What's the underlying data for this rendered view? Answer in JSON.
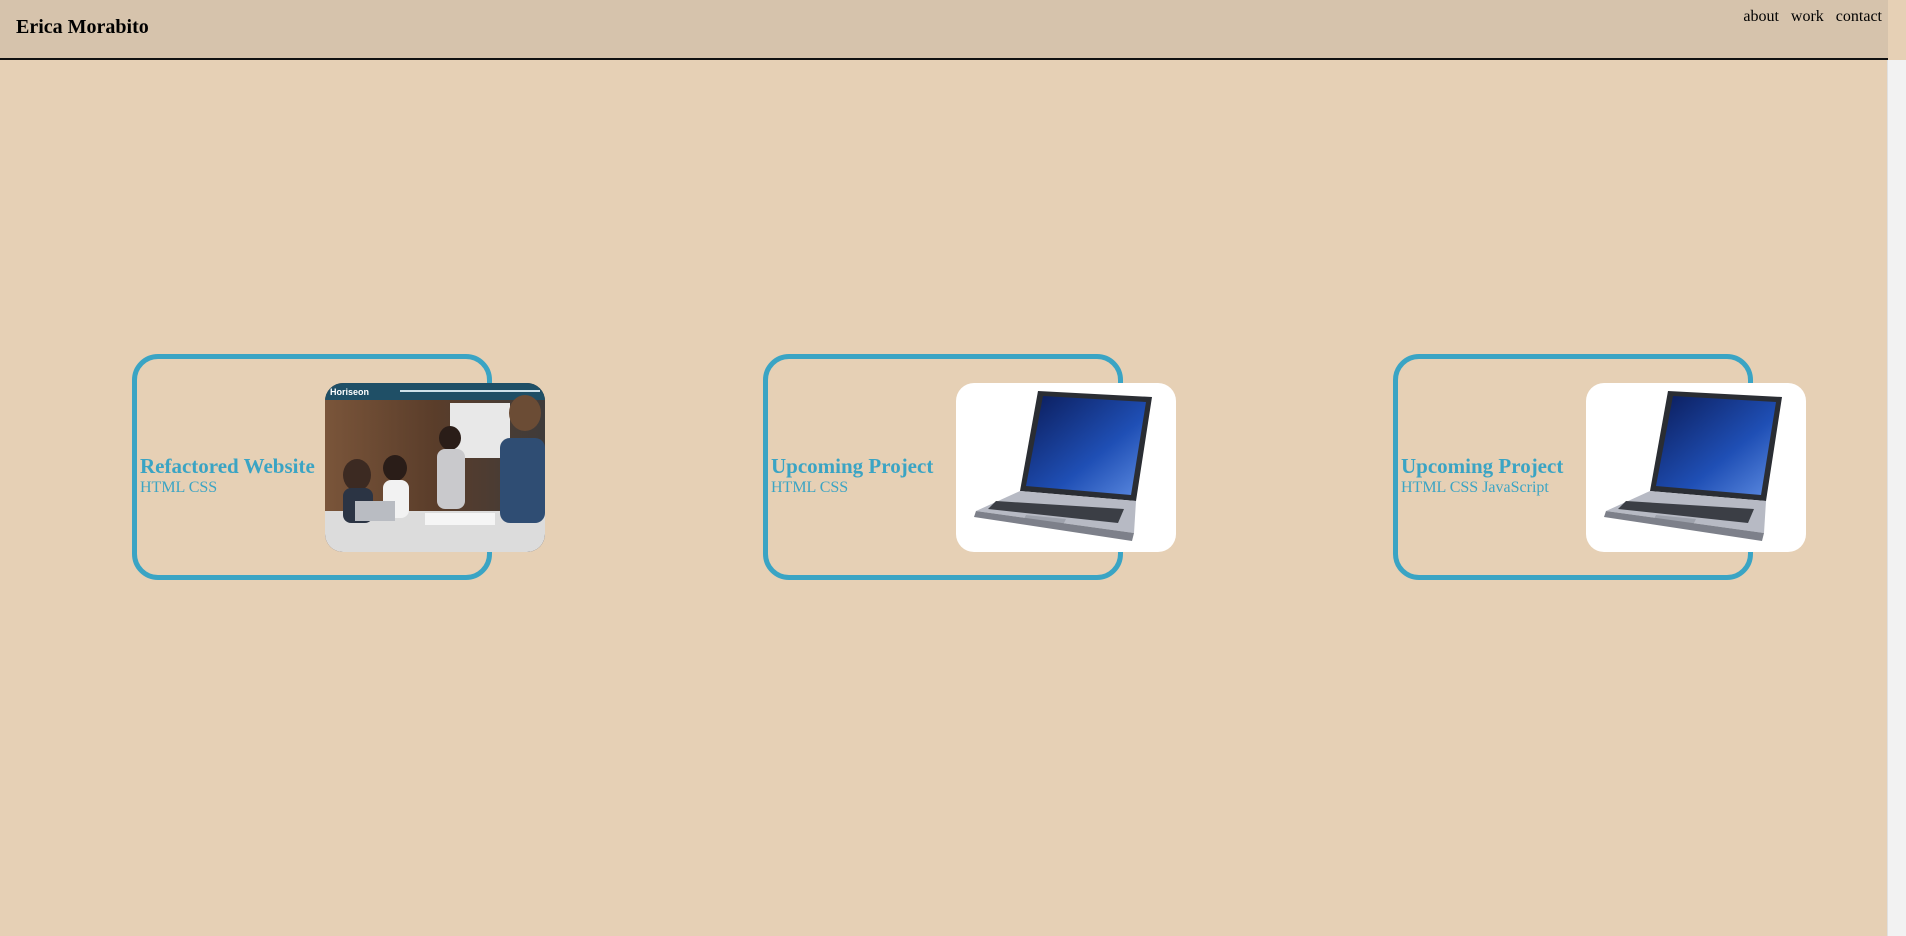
{
  "header": {
    "brand": "Erica Morabito",
    "nav": [
      "about",
      "work",
      "contact"
    ]
  },
  "projects": [
    {
      "title": "Refactored Website",
      "tech": "HTML CSS",
      "image": "horiseon-screenshot",
      "image_text": "Horiseon"
    },
    {
      "title": "Upcoming Project",
      "tech": "HTML CSS",
      "image": "laptop-icon"
    },
    {
      "title": "Upcoming Project",
      "tech": "HTML CSS JavaScript",
      "image": "laptop-icon"
    }
  ],
  "colors": {
    "background": "#e6d0b5",
    "header": "#d6c3ac",
    "accent": "#3aa4c4"
  }
}
